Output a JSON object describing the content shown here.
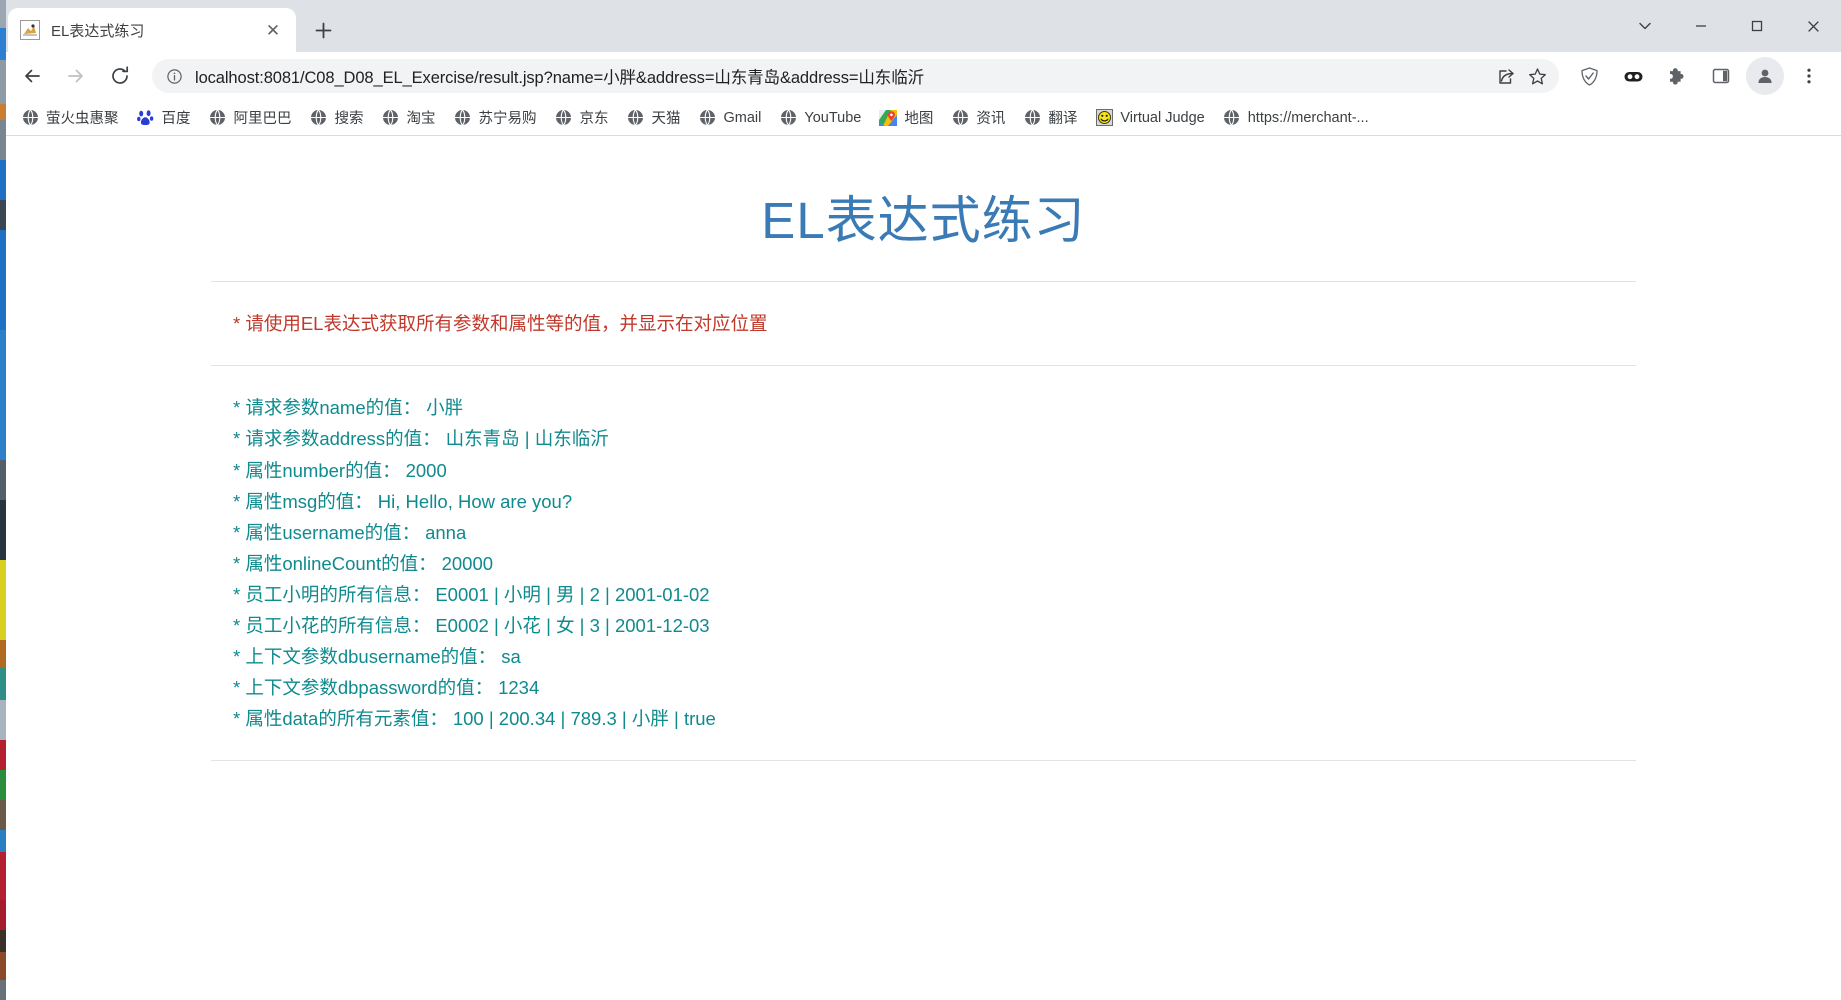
{
  "window": {
    "controls": [
      {
        "name": "tab-search",
        "glyph": "chevron-down"
      },
      {
        "name": "minimize",
        "glyph": "minimize"
      },
      {
        "name": "maximize",
        "glyph": "maximize"
      },
      {
        "name": "close",
        "glyph": "close"
      }
    ]
  },
  "tab": {
    "title": "EL表达式练习",
    "favicon": "page-favicon",
    "close_label": "✕",
    "new_tab_label": "+"
  },
  "toolbar": {
    "back_label": "back-arrow",
    "forward_label": "forward-arrow",
    "reload_label": "reload",
    "url": "localhost:8081/C08_D08_EL_Exercise/result.jsp?name=小胖&address=山东青岛&address=山东临沂",
    "url_placeholder": "Search Google or type a URL",
    "info_icon": "site-information-icon",
    "actions": [
      {
        "name": "share-icon"
      },
      {
        "name": "bookmark-star-icon"
      }
    ],
    "right_icons": [
      {
        "name": "shield-icon"
      },
      {
        "name": "extension-dark-icon"
      },
      {
        "name": "puzzle-extensions-icon"
      },
      {
        "name": "side-panel-icon"
      },
      {
        "name": "profile-avatar-icon"
      },
      {
        "name": "three-dot-menu-icon"
      }
    ]
  },
  "bookmarks": [
    {
      "label": "萤火虫惠聚",
      "icon": "globe-icon"
    },
    {
      "label": "百度",
      "icon": "baidu-icon"
    },
    {
      "label": "阿里巴巴",
      "icon": "globe-icon"
    },
    {
      "label": "搜索",
      "icon": "globe-icon"
    },
    {
      "label": "淘宝",
      "icon": "globe-icon"
    },
    {
      "label": "苏宁易购",
      "icon": "globe-icon"
    },
    {
      "label": "京东",
      "icon": "globe-icon"
    },
    {
      "label": "天猫",
      "icon": "globe-icon"
    },
    {
      "label": "Gmail",
      "icon": "globe-icon"
    },
    {
      "label": "YouTube",
      "icon": "globe-icon"
    },
    {
      "label": "地图",
      "icon": "google-maps-icon"
    },
    {
      "label": "资讯",
      "icon": "globe-icon"
    },
    {
      "label": "翻译",
      "icon": "globe-icon"
    },
    {
      "label": "Virtual Judge",
      "icon": "virtual-judge-icon"
    },
    {
      "label": "https://merchant-...",
      "icon": "globe-icon"
    }
  ],
  "page": {
    "title": "EL表达式练习",
    "title_color": "#3a7ab5",
    "notice": "* 请使用EL表达式获取所有参数和属性等的值，并显示在对应位置",
    "notice_color": "#c0392b",
    "rows_color": "#0f8a8e",
    "rows": [
      {
        "label": "* 请求参数name的值：",
        "value": "小胖"
      },
      {
        "label": "* 请求参数address的值：",
        "value": "山东青岛 | 山东临沂"
      },
      {
        "label": "* 属性number的值：",
        "value": "2000"
      },
      {
        "label": "* 属性msg的值：",
        "value": "Hi, Hello, How are you?"
      },
      {
        "label": "* 属性username的值：",
        "value": "anna"
      },
      {
        "label": "* 属性onlineCount的值：",
        "value": "20000"
      },
      {
        "label": "* 员工小明的所有信息：",
        "value": "E0001 | 小明 | 男 | 2 | 2001-01-02"
      },
      {
        "label": "* 员工小花的所有信息：",
        "value": "E0002 | 小花 | 女 | 3 | 2001-12-03"
      },
      {
        "label": "* 上下文参数dbusername的值：",
        "value": "sa"
      },
      {
        "label": "* 上下文参数dbpassword的值：",
        "value": "1234"
      },
      {
        "label": "* 属性data的所有元素值：",
        "value": "100 | 200.34 | 789.3 | 小胖 | true"
      }
    ]
  }
}
